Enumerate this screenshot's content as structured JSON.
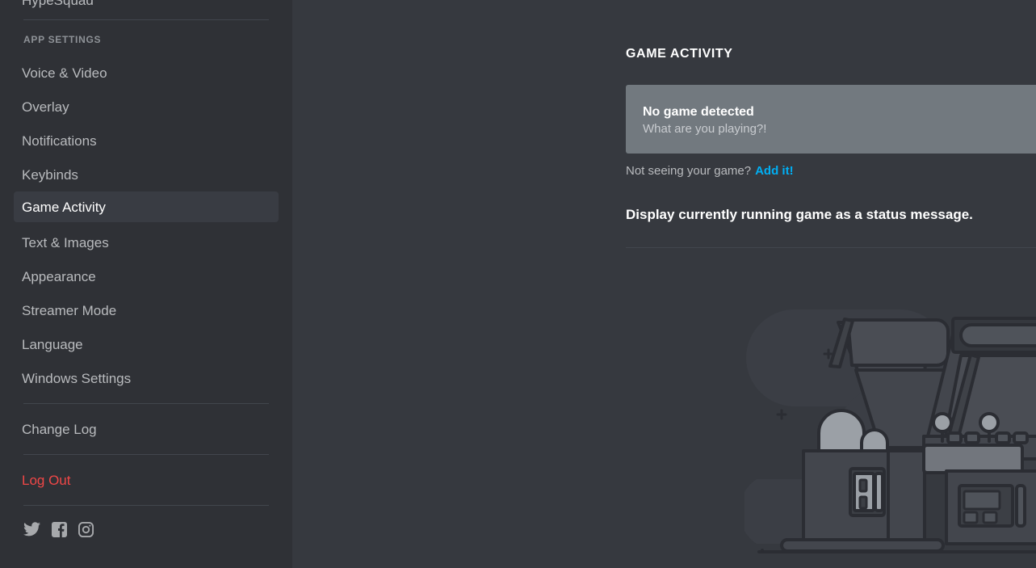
{
  "sidebar": {
    "clipped_item": {
      "label": "HypeSquad"
    },
    "section_label": "APP SETTINGS",
    "items": [
      {
        "label": "Voice & Video",
        "selected": false
      },
      {
        "label": "Overlay",
        "selected": false
      },
      {
        "label": "Notifications",
        "selected": false
      },
      {
        "label": "Keybinds",
        "selected": false
      },
      {
        "label": "Game Activity",
        "selected": true
      },
      {
        "label": "Text & Images",
        "selected": false
      },
      {
        "label": "Appearance",
        "selected": false
      },
      {
        "label": "Streamer Mode",
        "selected": false
      },
      {
        "label": "Language",
        "selected": false
      },
      {
        "label": "Windows Settings",
        "selected": false
      }
    ],
    "change_log": "Change Log",
    "log_out": "Log Out",
    "socials": [
      {
        "name": "twitter-icon"
      },
      {
        "name": "facebook-icon"
      },
      {
        "name": "instagram-icon"
      }
    ]
  },
  "main": {
    "page_title": "GAME ACTIVITY",
    "game_card": {
      "title": "No game detected",
      "subtitle": "What are you playing?!"
    },
    "not_seeing": {
      "text": "Not seeing your game?",
      "link": "Add it!"
    },
    "toggle": {
      "label": "Display currently running game as a status message.",
      "state": "on"
    }
  },
  "colors": {
    "sidebar_bg": "#2f3136",
    "main_bg": "#36393f",
    "selected_item": "#393c43",
    "card_bg": "#72797f",
    "link": "#00aff4",
    "logout": "#f04747",
    "toggle_on": "#7289da",
    "toggle_knob": "#ffffff",
    "divider": "#42464d",
    "text_primary": "#ffffff",
    "text_muted": "#b9bbbe",
    "section_label": "#8e9297",
    "illustration_stroke": "#2b2d33",
    "illustration_fill_dark": "#3c3f45",
    "illustration_fill_mid": "#4a4d54",
    "illustration_fill_light": "#9ba0a6",
    "illustration_blob": "#3b3e45"
  }
}
